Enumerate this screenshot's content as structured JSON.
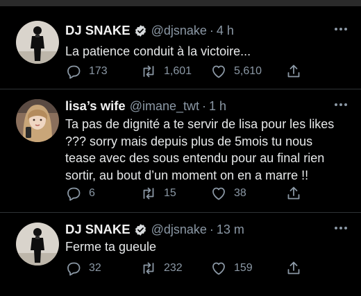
{
  "colors": {
    "background": "#000000",
    "text": "#e7e9ea",
    "secondary": "#8b98a5",
    "verified": "#1d9bf0",
    "divider": "#2f3336"
  },
  "tweets": [
    {
      "name": "DJ SNAKE",
      "verified": true,
      "handle": "@djsnake",
      "time": "4 h",
      "text": "La patience conduit à la victoire...",
      "replies": "173",
      "retweets": "1,601",
      "likes": "5,610"
    },
    {
      "name": "lisa’s wife",
      "verified": false,
      "handle": "@imane_twt",
      "time": "1 h",
      "text": "Ta pas de dignité a te servir de lisa pour les likes ??? sorry mais depuis plus de 5mois tu nous tease avec des sous entendu pour au final rien sortir, au bout d’un moment on en a marre !!",
      "replies": "6",
      "retweets": "15",
      "likes": "38"
    },
    {
      "name": "DJ SNAKE",
      "verified": true,
      "handle": "@djsnake",
      "time": "13 m",
      "text": "Ferme ta gueule",
      "replies": "32",
      "retweets": "232",
      "likes": "159"
    }
  ],
  "separator": "·",
  "icons": [
    "reply-icon",
    "retweet-icon",
    "like-icon",
    "share-icon",
    "more-icon",
    "verified-badge-icon"
  ]
}
